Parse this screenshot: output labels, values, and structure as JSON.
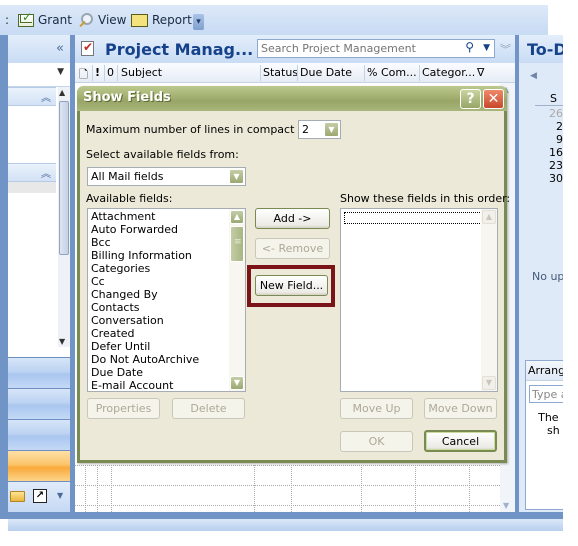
{
  "toolbar": {
    "items": [
      {
        "label": "Grant",
        "icon": "grant-envelope-icon"
      },
      {
        "label": "View",
        "icon": "view-magnifier-icon"
      },
      {
        "label": "Report",
        "icon": "report-envelope-icon"
      }
    ],
    "overflow_icon": "overflow-chevron-icon"
  },
  "nav_pane": {
    "collapse_icon": "«",
    "dropdown_arrow": "▼",
    "section_collapse_icon": "︽",
    "buttons_count": 4,
    "footer_icons": [
      "folder-icon",
      "shortcut-icon",
      "configure-buttons-icon"
    ]
  },
  "task_pane": {
    "title": "Project Manag...",
    "search_placeholder": "Search Project Management",
    "search_icon": "⚲",
    "columns": [
      {
        "label": "Subject"
      },
      {
        "label": "Status"
      },
      {
        "label": "Due Date"
      },
      {
        "label": "% Com..."
      },
      {
        "label": "Categor..."
      }
    ],
    "icon_columns": [
      "item-type-icon",
      "importance-icon",
      "attachment-icon"
    ],
    "filter_icon": "∇"
  },
  "todo_bar": {
    "title": "To-D",
    "calendar_header": "S",
    "calendar_days": [
      {
        "day": "26",
        "muted": true
      },
      {
        "day": "2",
        "muted": false
      },
      {
        "day": "9",
        "muted": false
      },
      {
        "day": "16",
        "muted": false
      },
      {
        "day": "23",
        "muted": false
      },
      {
        "day": "30",
        "muted": false
      }
    ],
    "no_upcoming": "No up",
    "arrange_header": "Arrang",
    "task_input_placeholder": "Type a",
    "message_line1": "The",
    "message_line2": "sh"
  },
  "dialog": {
    "title": "Show Fields",
    "help_label": "?",
    "close_label": "✕",
    "max_lines_label": "Maximum number of lines in compact mode:",
    "max_lines_value": "2",
    "select_from_label": "Select available fields from:",
    "select_from_value": "All Mail fields",
    "available_label": "Available fields:",
    "available_fields": [
      "Attachment",
      "Auto Forwarded",
      "Bcc",
      "Billing Information",
      "Categories",
      "Cc",
      "Changed By",
      "Contacts",
      "Conversation",
      "Created",
      "Defer Until",
      "Do Not AutoArchive",
      "Due Date",
      "E-mail Account"
    ],
    "show_order_label": "Show these fields in this order:",
    "shown_fields": [],
    "buttons": {
      "add": "Add ->",
      "remove": "<- Remove",
      "new_field": "New Field...",
      "properties": "Properties",
      "delete": "Delete",
      "move_up": "Move Up",
      "move_down": "Move Down",
      "ok": "OK",
      "cancel": "Cancel"
    },
    "highlight_color": "#7b1418"
  }
}
